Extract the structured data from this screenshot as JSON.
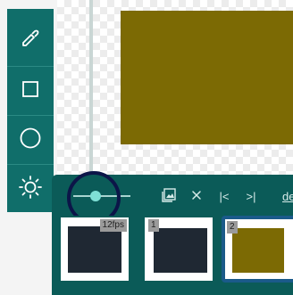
{
  "toolbar": {
    "tools": [
      {
        "name": "eyedropper",
        "icon": "eyedropper-icon"
      },
      {
        "name": "rectangle",
        "icon": "square-icon"
      },
      {
        "name": "ellipse",
        "icon": "circle-icon"
      },
      {
        "name": "brightness",
        "icon": "sun-icon"
      }
    ]
  },
  "timeline": {
    "controls": {
      "add_frame_icon": "image-add-icon",
      "close_icon": "close-icon",
      "first_frame_glyph": "|<",
      "last_frame_glyph": ">|",
      "truncated_label": "de"
    },
    "frames": [
      {
        "number": "",
        "badge": "12fps",
        "fill": "#1f2833"
      },
      {
        "number": "1",
        "badge": "1",
        "fill": "#1f2833"
      },
      {
        "number": "2",
        "badge": "2",
        "fill": "#7c6a04",
        "selected": true
      }
    ]
  },
  "colors": {
    "toolbar": "#106e6a",
    "timeline": "#0b5b58",
    "canvas_fill": "#7c6a04",
    "highlight_ring": "#0c1548",
    "frame_selected_border": "#1a5a8a"
  }
}
